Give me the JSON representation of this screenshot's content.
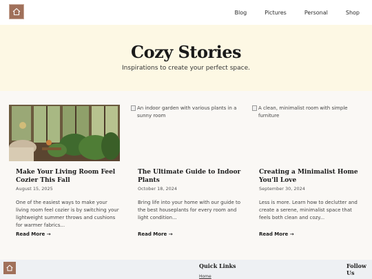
{
  "header": {
    "nav": [
      "Blog",
      "Pictures",
      "Personal",
      "Shop"
    ]
  },
  "hero": {
    "title": "Cozy Stories",
    "subtitle": "Inspirations to create your perfect space."
  },
  "cards": [
    {
      "image_alt": "",
      "title": "Make Your Living Room Feel Cozier This Fall",
      "date": "August 15, 2025",
      "excerpt": "One of the easiest ways to make your living room feel cozier is by switching your lightweight summer throws and cushions for warmer fabrics...",
      "more": "Read More →"
    },
    {
      "image_alt": "An indoor garden with various plants in a sunny room",
      "title": "The Ultimate Guide to Indoor Plants",
      "date": "October 18, 2024",
      "excerpt": "Bring life into your home with our guide to the best houseplants for every room and light condition...",
      "more": "Read More →"
    },
    {
      "image_alt": "A clean, minimalist room with simple furniture",
      "title": "Creating a Minimalist Home You'll Love",
      "date": "September 30, 2024",
      "excerpt": "Less is more. Learn how to declutter and create a serene, minimalist space that feels both clean and cozy...",
      "more": "Read More →"
    }
  ],
  "footer": {
    "quick_links_title": "Quick Links",
    "follow_title": "Follow Us",
    "link_home": "Home"
  },
  "colors": {
    "brand": "#a0705a",
    "hero_bg": "#fdf8e4",
    "footer_bg": "#eef0f3"
  }
}
